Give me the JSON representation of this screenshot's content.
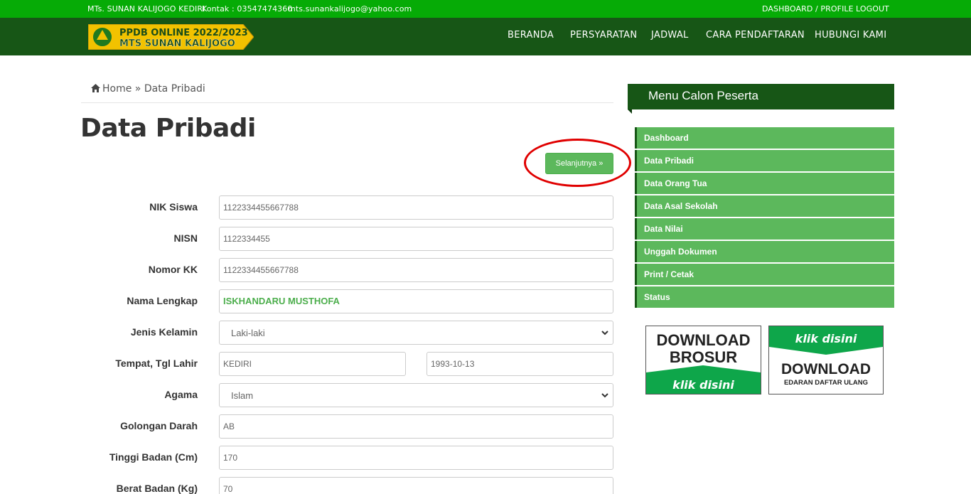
{
  "topbar": {
    "school": "MTs. SUNAN KALIJOGO KEDIRI",
    "contact": "Kontak : 03547474360",
    "email": "mts.sunankalijogo@yahoo.com",
    "dashboard_profile": "DASHBOARD / PROFILE",
    "logout": "LOGOUT",
    "bg_color": "#06ab06"
  },
  "logo": {
    "line1": "PPDB ONLINE 2022/2023",
    "line2": "MTS SUNAN KALIJOGO"
  },
  "nav": {
    "items": [
      "BERANDA",
      "PERSYARATAN",
      "JADWAL",
      "CARA PENDAFTARAN",
      "HUBUNGI KAMI"
    ],
    "bg_color": "#175616"
  },
  "breadcrumb": {
    "home": "Home",
    "separator": "»",
    "current": "Data Pribadi"
  },
  "page_title": "Data Pribadi",
  "next_button": "Selanjutnya »",
  "form": {
    "nik_label": "NIK Siswa",
    "nik_value": "1122334455667788",
    "nisn_label": "NISN",
    "nisn_value": "1122334455",
    "kk_label": "Nomor KK",
    "kk_value": "1122334455667788",
    "nama_label": "Nama Lengkap",
    "nama_value": "ISKHANDARU MUSTHOFA",
    "jk_label": "Jenis Kelamin",
    "jk_value": "Laki-laki",
    "ttl_label": "Tempat, Tgl Lahir",
    "tempat_value": "KEDIRI",
    "tgl_value": "1993-10-13",
    "agama_label": "Agama",
    "agama_value": "Islam",
    "goldar_label": "Golongan Darah",
    "goldar_value": "AB",
    "tinggi_label": "Tinggi Badan (Cm)",
    "tinggi_value": "170",
    "berat_label": "Berat Badan (Kg)",
    "berat_value": "70"
  },
  "sidebar": {
    "title": "Menu Calon Peserta",
    "items": [
      {
        "label": "Dashboard"
      },
      {
        "label": "Data Pribadi"
      },
      {
        "label": "Data Orang Tua"
      },
      {
        "label": "Data Asal Sekolah"
      },
      {
        "label": "Data Nilai"
      },
      {
        "label": "Unggah Dokumen"
      },
      {
        "label": "Print / Cetak"
      },
      {
        "label": "Status"
      }
    ],
    "accent_color": "#5cb85c"
  },
  "banners": {
    "brosur": {
      "line1": "DOWNLOAD",
      "line2": "BROSUR",
      "cta": "klik disini"
    },
    "edaran": {
      "cta": "klik disini",
      "line1": "DOWNLOAD",
      "line2": "EDARAN DAFTAR ULANG"
    }
  }
}
